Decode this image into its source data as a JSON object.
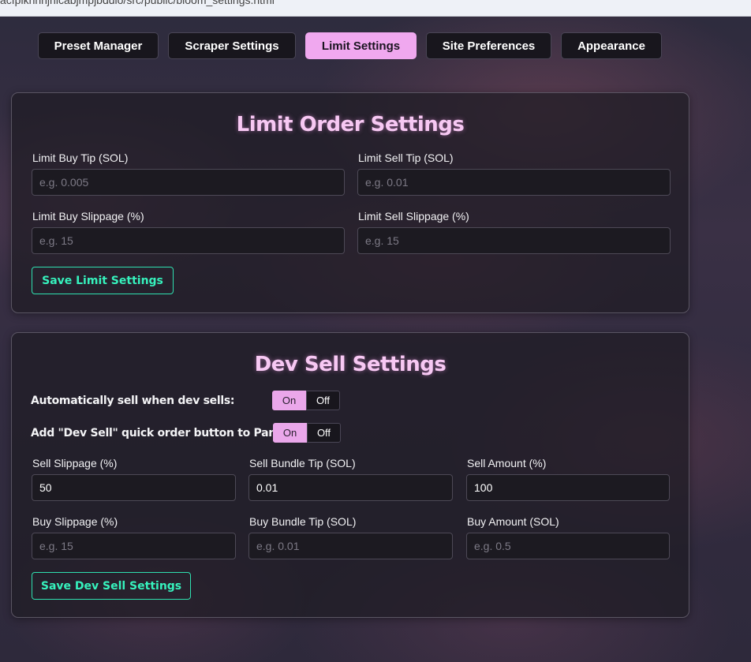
{
  "browser": {
    "url_fragment": "acfpiknhnjnicabjmpjbddlo/src/public/bloom_settings.html"
  },
  "tabs": [
    {
      "label": "Preset Manager",
      "active": false
    },
    {
      "label": "Scraper Settings",
      "active": false
    },
    {
      "label": "Limit Settings",
      "active": true
    },
    {
      "label": "Site Preferences",
      "active": false
    },
    {
      "label": "Appearance",
      "active": false
    }
  ],
  "limit": {
    "title": "Limit Order Settings",
    "buy_tip_label": "Limit Buy Tip (SOL)",
    "buy_tip_placeholder": "e.g. 0.005",
    "sell_tip_label": "Limit Sell Tip (SOL)",
    "sell_tip_placeholder": "e.g. 0.01",
    "buy_slippage_label": "Limit Buy Slippage (%)",
    "buy_slippage_placeholder": "e.g. 15",
    "sell_slippage_label": "Limit Sell Slippage (%)",
    "sell_slippage_placeholder": "e.g. 15",
    "save_label": "Save Limit Settings"
  },
  "dev": {
    "title": "Dev Sell Settings",
    "auto_sell_label": "Automatically sell when dev sells:",
    "quick_button_label": "Add \"Dev Sell\" quick order button to Panel:",
    "on_label": "On",
    "off_label": "Off",
    "auto_sell_state": "On",
    "quick_button_state": "On",
    "sell_slippage_label": "Sell Slippage (%)",
    "sell_slippage_value": "50",
    "sell_bundle_tip_label": "Sell Bundle Tip (SOL)",
    "sell_bundle_tip_value": "0.01",
    "sell_amount_label": "Sell Amount (%)",
    "sell_amount_value": "100",
    "buy_slippage_label": "Buy Slippage (%)",
    "buy_slippage_placeholder": "e.g. 15",
    "buy_bundle_tip_label": "Buy Bundle Tip (SOL)",
    "buy_bundle_tip_placeholder": "e.g. 0.01",
    "buy_amount_label": "Buy Amount (SOL)",
    "buy_amount_placeholder": "e.g. 0.5",
    "save_label": "Save Dev Sell Settings"
  },
  "colors": {
    "accent_pink": "#f0a8ef",
    "title_pink": "#f7c8f3",
    "save_green": "#36f2bd"
  }
}
